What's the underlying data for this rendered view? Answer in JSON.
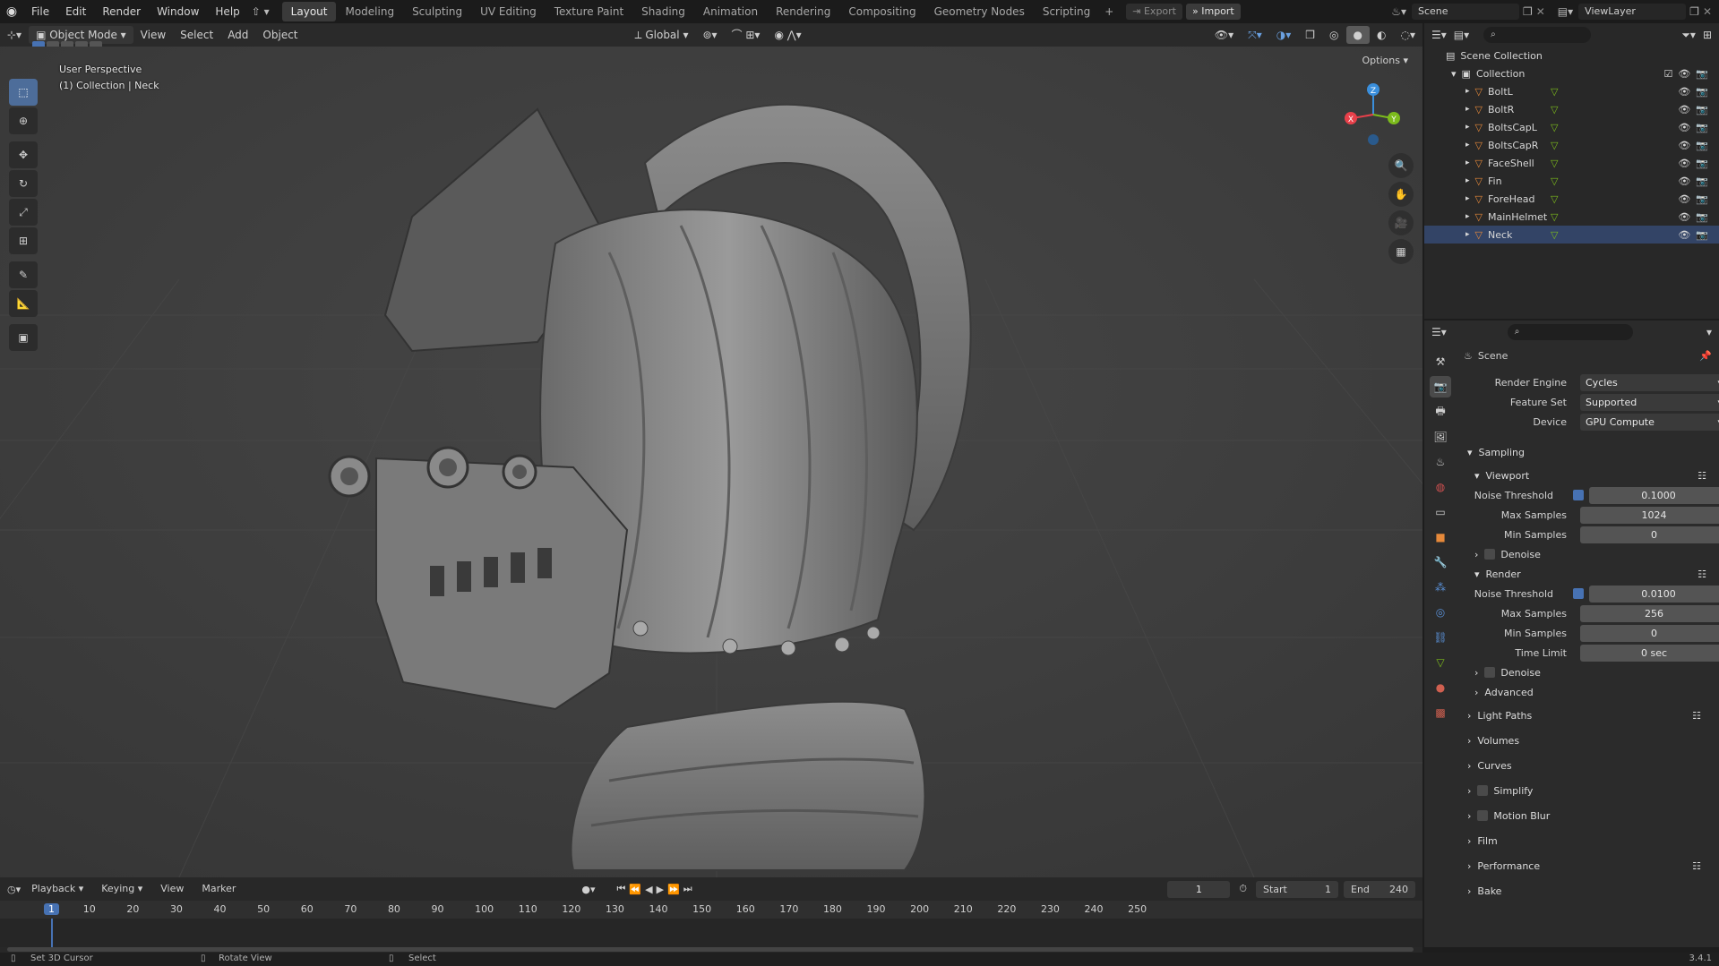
{
  "topbar": {
    "menus": [
      "File",
      "Edit",
      "Render",
      "Window",
      "Help"
    ],
    "workspaces": [
      "Layout",
      "Modeling",
      "Sculpting",
      "UV Editing",
      "Texture Paint",
      "Shading",
      "Animation",
      "Rendering",
      "Compositing",
      "Geometry Nodes",
      "Scripting"
    ],
    "active_workspace": "Layout",
    "export_label": "Export",
    "import_label": "Import",
    "scene_name": "Scene",
    "viewlayer_name": "ViewLayer"
  },
  "viewport": {
    "mode": "Object Mode",
    "menus": [
      "View",
      "Select",
      "Add",
      "Object"
    ],
    "orientation": "Global",
    "options_label": "Options",
    "perspective_text": "User Perspective",
    "collection_text": "(1) Collection | Neck",
    "gizmo_axes": {
      "x": "X",
      "y": "Y",
      "z": "Z"
    }
  },
  "outliner": {
    "scene_collection": "Scene Collection",
    "collection": "Collection",
    "objects": [
      "BoltL",
      "BoltR",
      "BoltsCapL",
      "BoltsCapR",
      "FaceShell",
      "Fin",
      "ForeHead",
      "MainHelmet",
      "Neck"
    ]
  },
  "properties": {
    "context_title": "Scene",
    "render_engine_label": "Render Engine",
    "render_engine": "Cycles",
    "feature_set_label": "Feature Set",
    "feature_set": "Supported",
    "device_label": "Device",
    "device": "GPU Compute",
    "sampling_label": "Sampling",
    "viewport_label": "Viewport",
    "vp_noise_label": "Noise Threshold",
    "vp_noise": "0.1000",
    "vp_max_label": "Max Samples",
    "vp_max": "1024",
    "vp_min_label": "Min Samples",
    "vp_min": "0",
    "denoise_label": "Denoise",
    "render_label": "Render",
    "r_noise_label": "Noise Threshold",
    "r_noise": "0.0100",
    "r_max_label": "Max Samples",
    "r_max": "256",
    "r_min_label": "Min Samples",
    "r_min": "0",
    "time_limit_label": "Time Limit",
    "time_limit": "0 sec",
    "denoise2_label": "Denoise",
    "advanced_label": "Advanced",
    "sections": [
      "Light Paths",
      "Volumes",
      "Curves",
      "Simplify",
      "Motion Blur",
      "Film",
      "Performance",
      "Bake"
    ]
  },
  "timeline": {
    "menus": [
      "Playback",
      "Keying",
      "View",
      "Marker"
    ],
    "current_frame": "1",
    "start_label": "Start",
    "start": "1",
    "end_label": "End",
    "end": "240",
    "ticks": [
      "1",
      "10",
      "20",
      "30",
      "40",
      "50",
      "60",
      "70",
      "80",
      "90",
      "100",
      "110",
      "120",
      "130",
      "140",
      "150",
      "160",
      "170",
      "180",
      "190",
      "200",
      "210",
      "220",
      "230",
      "240",
      "250"
    ]
  },
  "status": {
    "left": "Set 3D Cursor",
    "middle": "Rotate View",
    "right": "Select",
    "version": "3.4.1"
  },
  "colors": {
    "accent": "#4772b3",
    "x_axis": "#e8404a",
    "y_axis": "#7cbb1c",
    "z_axis": "#3a8fdc",
    "object_icon": "#e6893a"
  }
}
